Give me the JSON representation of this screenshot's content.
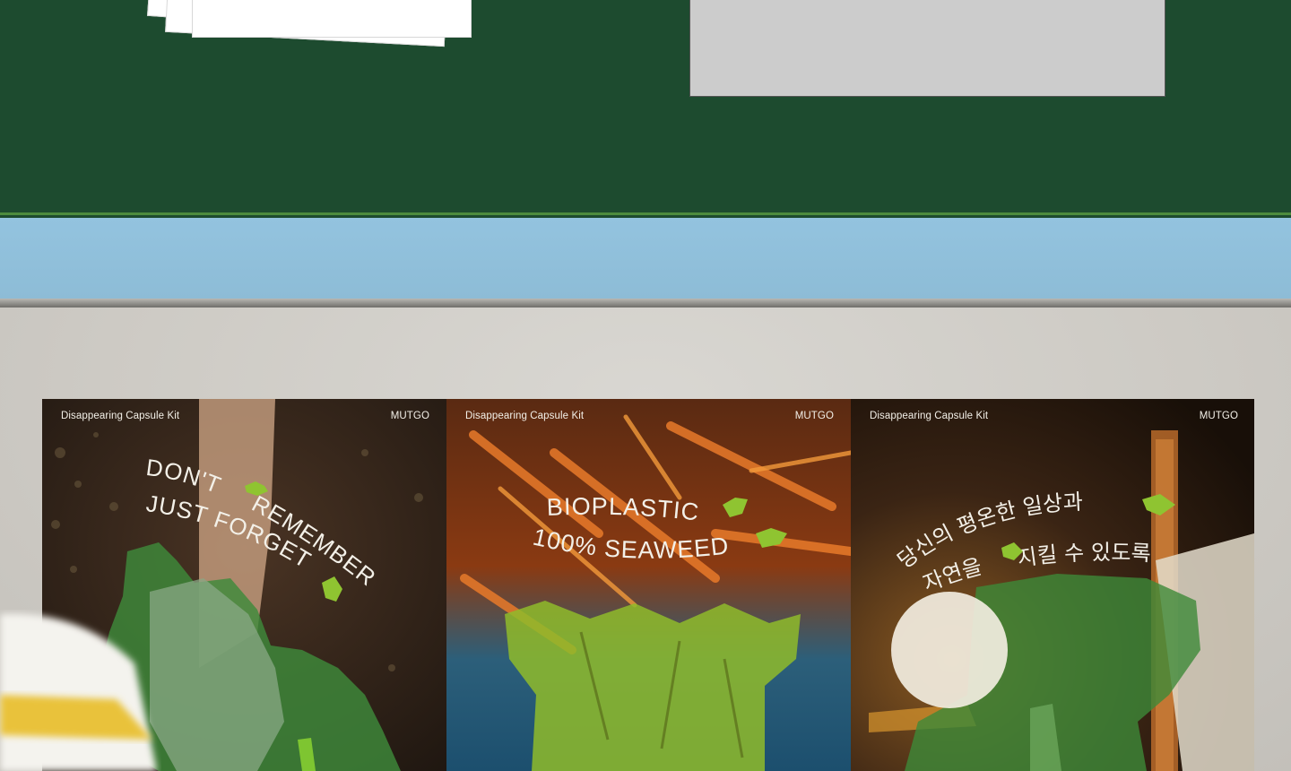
{
  "posters": [
    {
      "header_left": "Disappearing Capsule Kit",
      "header_right": "MUTGO",
      "line1": "DON'T",
      "line1b": "REMEMBER",
      "line2": "JUST FORGET"
    },
    {
      "header_left": "Disappearing Capsule Kit",
      "header_right": "MUTGO",
      "line1": "BIOPLASTIC",
      "line2": "100% SEAWEED"
    },
    {
      "header_left": "Disappearing Capsule Kit",
      "header_right": "MUTGO",
      "line1": "당신의 평온한 일상과",
      "line2a": "자연을",
      "line2b": "지킬 수 있도록"
    }
  ],
  "colors": {
    "brand_green": "#1d4b2f",
    "accent_lime": "#8fc431",
    "poster_text": "#f3f0e8"
  }
}
